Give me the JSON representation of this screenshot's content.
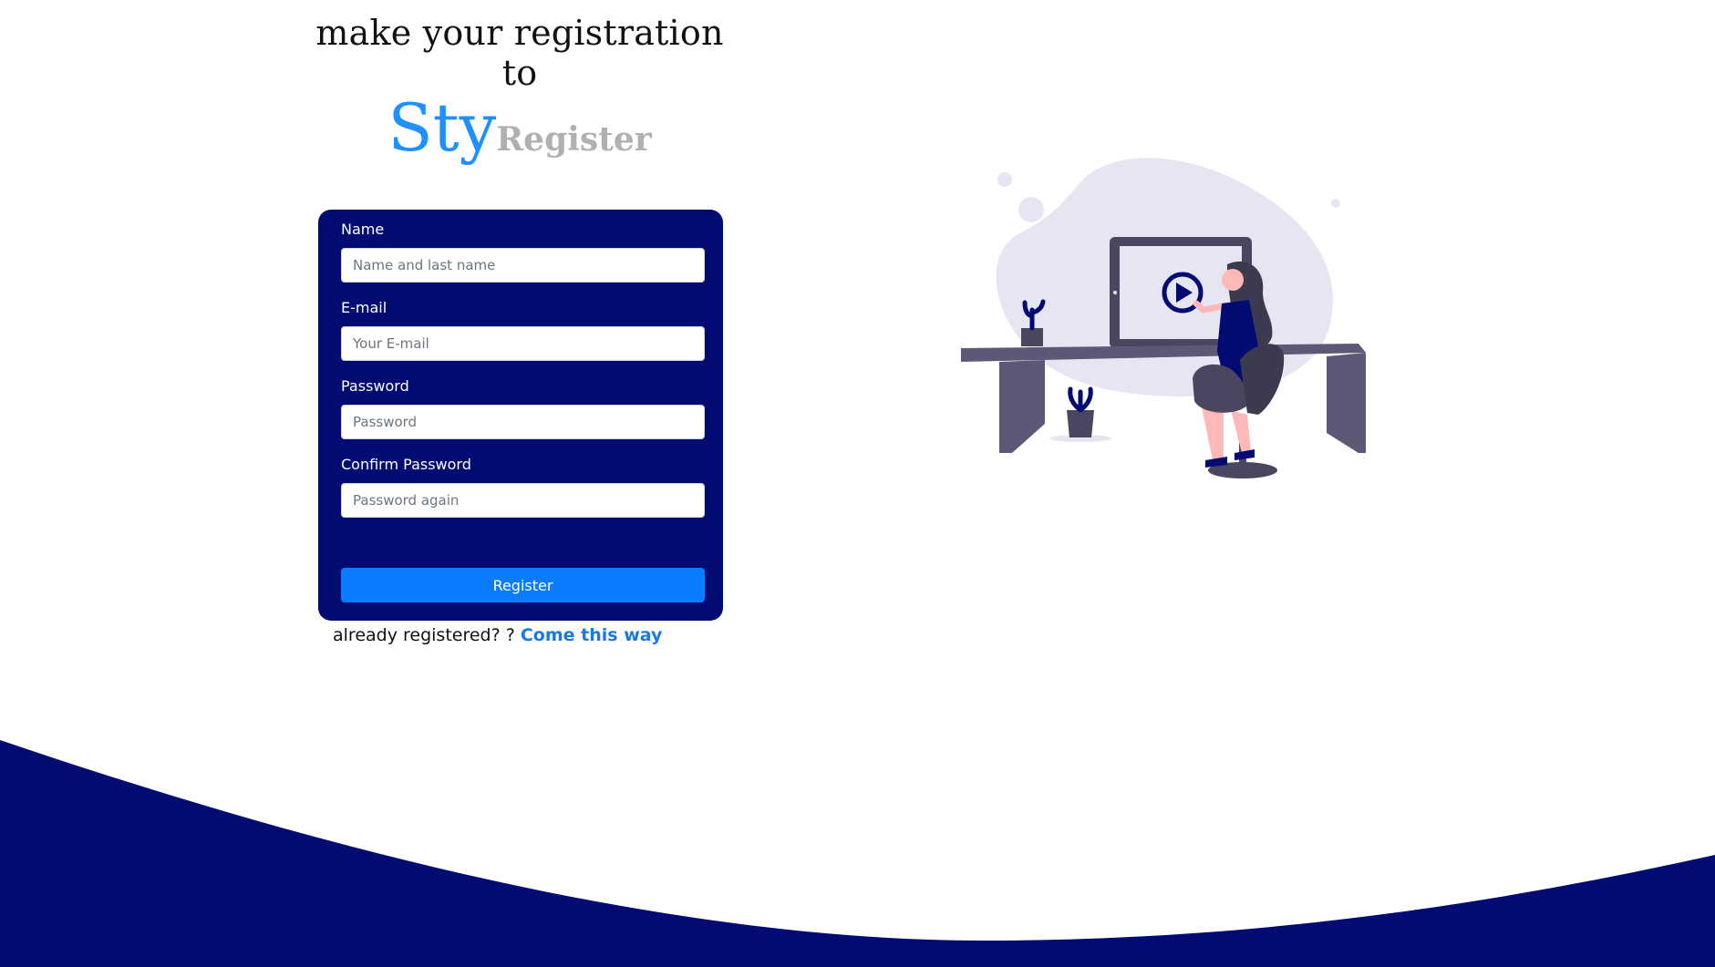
{
  "header": {
    "title": "make your registration to"
  },
  "brand": {
    "part1": "Sty",
    "part2": "Register"
  },
  "form": {
    "name": {
      "label": "Name",
      "placeholder": "Name and last name"
    },
    "email": {
      "label": "E-mail",
      "placeholder": "Your E-mail"
    },
    "password": {
      "label": "Password",
      "placeholder": "Password"
    },
    "confirm": {
      "label": "Confirm Password",
      "placeholder": "Password again"
    },
    "submit_label": "Register"
  },
  "footer": {
    "prompt": "already registered? ?",
    "link_label": "Come this way"
  },
  "colors": {
    "primary_navy": "#020b72",
    "accent_blue": "#0b7bff",
    "brand_blue": "#1e90ff",
    "brand_gray": "#b0b0b0"
  },
  "illustration": {
    "icon": "play-icon"
  }
}
